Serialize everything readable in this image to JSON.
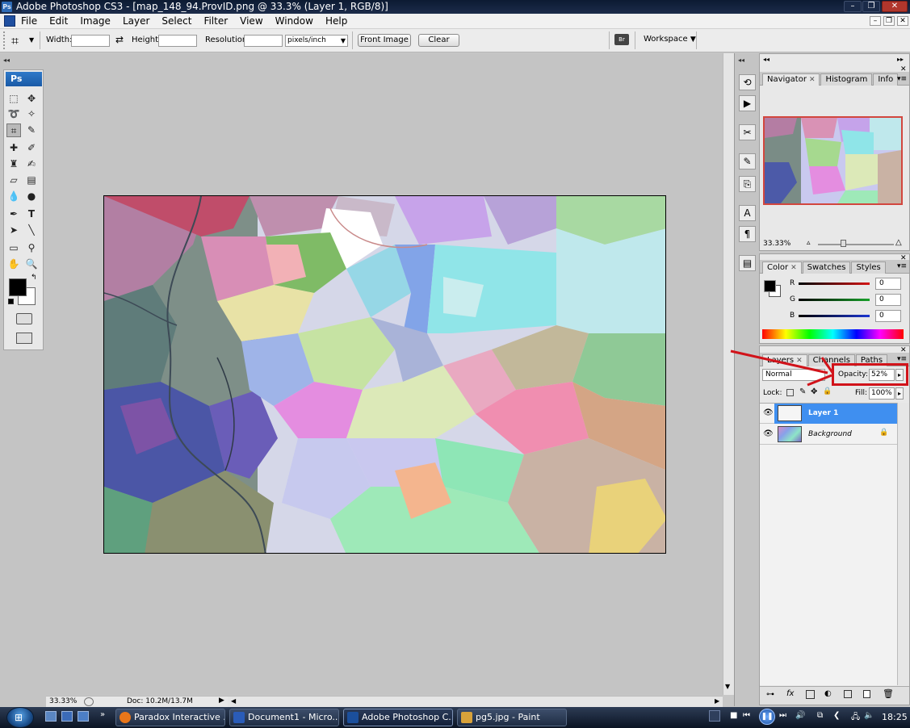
{
  "window": {
    "title": "Adobe Photoshop CS3 - [map_148_94.ProvID.png @ 33.3% (Layer 1, RGB/8)]",
    "app_badge": "Ps"
  },
  "menubar": {
    "items": [
      "File",
      "Edit",
      "Image",
      "Layer",
      "Select",
      "Filter",
      "View",
      "Window",
      "Help"
    ]
  },
  "options": {
    "width_label": "Width:",
    "height_label": "Height:",
    "resolution_label": "Resolution:",
    "units_value": "pixels/inch",
    "front_image_label": "Front Image",
    "clear_label": "Clear",
    "workspace_label": "Workspace"
  },
  "toolbox": {
    "badge": "Ps"
  },
  "navigator": {
    "tabs": [
      "Navigator",
      "Histogram",
      "Info"
    ],
    "zoom": "33.33%"
  },
  "color_panel": {
    "tabs": [
      "Color",
      "Swatches",
      "Styles"
    ],
    "channels": [
      {
        "label": "R",
        "value": "0",
        "color": "#d41616"
      },
      {
        "label": "G",
        "value": "0",
        "color": "#18a02a"
      },
      {
        "label": "B",
        "value": "0",
        "color": "#1c36d2"
      }
    ]
  },
  "layers_panel": {
    "tabs": [
      "Layers",
      "Channels",
      "Paths"
    ],
    "blend_mode": "Normal",
    "opacity_label": "Opacity:",
    "opacity_value": "52%",
    "lock_label": "Lock:",
    "fill_label": "Fill:",
    "fill_value": "100%",
    "layers": [
      {
        "name": "Layer 1",
        "selected": true
      },
      {
        "name": "Background",
        "selected": false
      }
    ]
  },
  "status": {
    "zoom": "33.33%",
    "doc": "Doc: 10.2M/13.7M"
  },
  "taskbar": {
    "buttons": [
      {
        "label": "Paradox Interactive ...",
        "icon_color": "#e8761a"
      },
      {
        "label": "Document1 - Micro...",
        "icon_color": "#2a5cb8"
      },
      {
        "label": "Adobe Photoshop C...",
        "icon_color": "#1b4f9c"
      },
      {
        "label": "pg5.jpg - Paint",
        "icon_color": "#d8a23a"
      }
    ],
    "clock": "18:25"
  },
  "colors": {
    "selection_blue": "#3f8ff0",
    "annotation_red": "#d1131a"
  }
}
